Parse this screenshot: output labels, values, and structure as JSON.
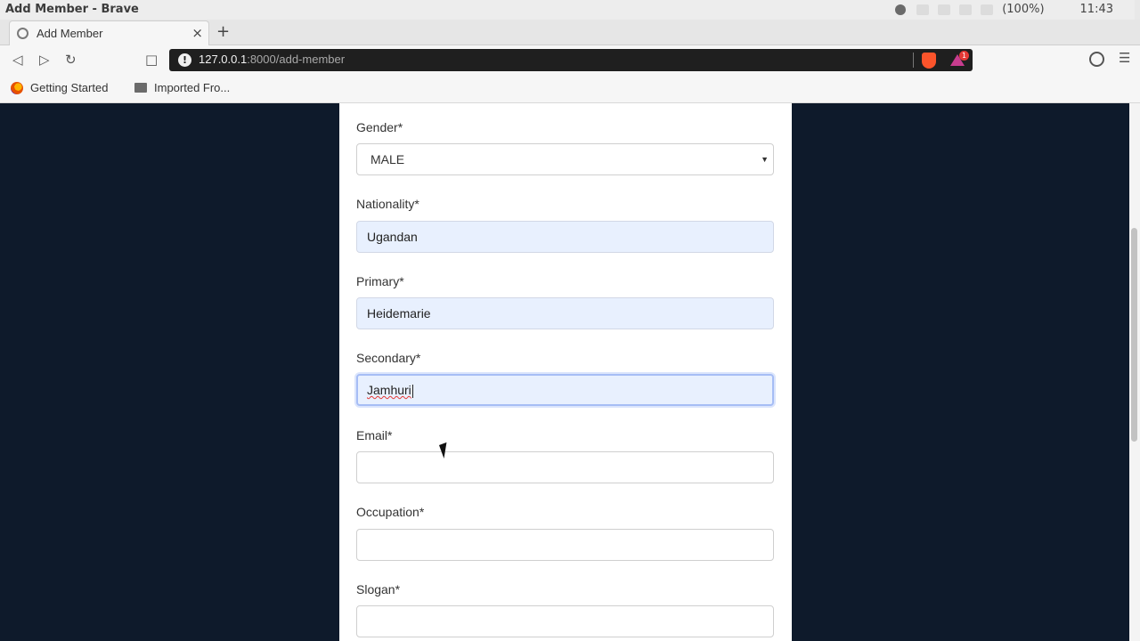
{
  "window": {
    "title": "Add Member - Brave",
    "tray": {
      "zoom": "(100%)",
      "clock": "11:43"
    }
  },
  "tab": {
    "title": "Add Member",
    "close": "×",
    "new_tab": "+"
  },
  "toolbar": {
    "url_host": "127.0.0.1",
    "url_path": ":8000/add-member",
    "rewards_badge": "1"
  },
  "bookmarks": [
    {
      "label": "Getting Started",
      "icon": "firefox-icon"
    },
    {
      "label": "Imported Fro...",
      "icon": "folder-icon"
    }
  ],
  "form": {
    "gender": {
      "label": "Gender*",
      "value": "MALE"
    },
    "nationality": {
      "label": "Nationality*",
      "value": "Ugandan"
    },
    "primary": {
      "label": "Primary*",
      "value": "Heidemarie"
    },
    "secondary": {
      "label": "Secondary*",
      "value": "Jamhuri"
    },
    "email": {
      "label": "Email*",
      "value": ""
    },
    "occupation": {
      "label": "Occupation*",
      "value": ""
    },
    "slogan": {
      "label": "Slogan*",
      "value": ""
    }
  },
  "colors": {
    "page_background": "#0e1a2b",
    "autofill_background": "#e8f0fe",
    "focus_ring": "#a6bdf5",
    "brave_accent": "#fb542b"
  }
}
